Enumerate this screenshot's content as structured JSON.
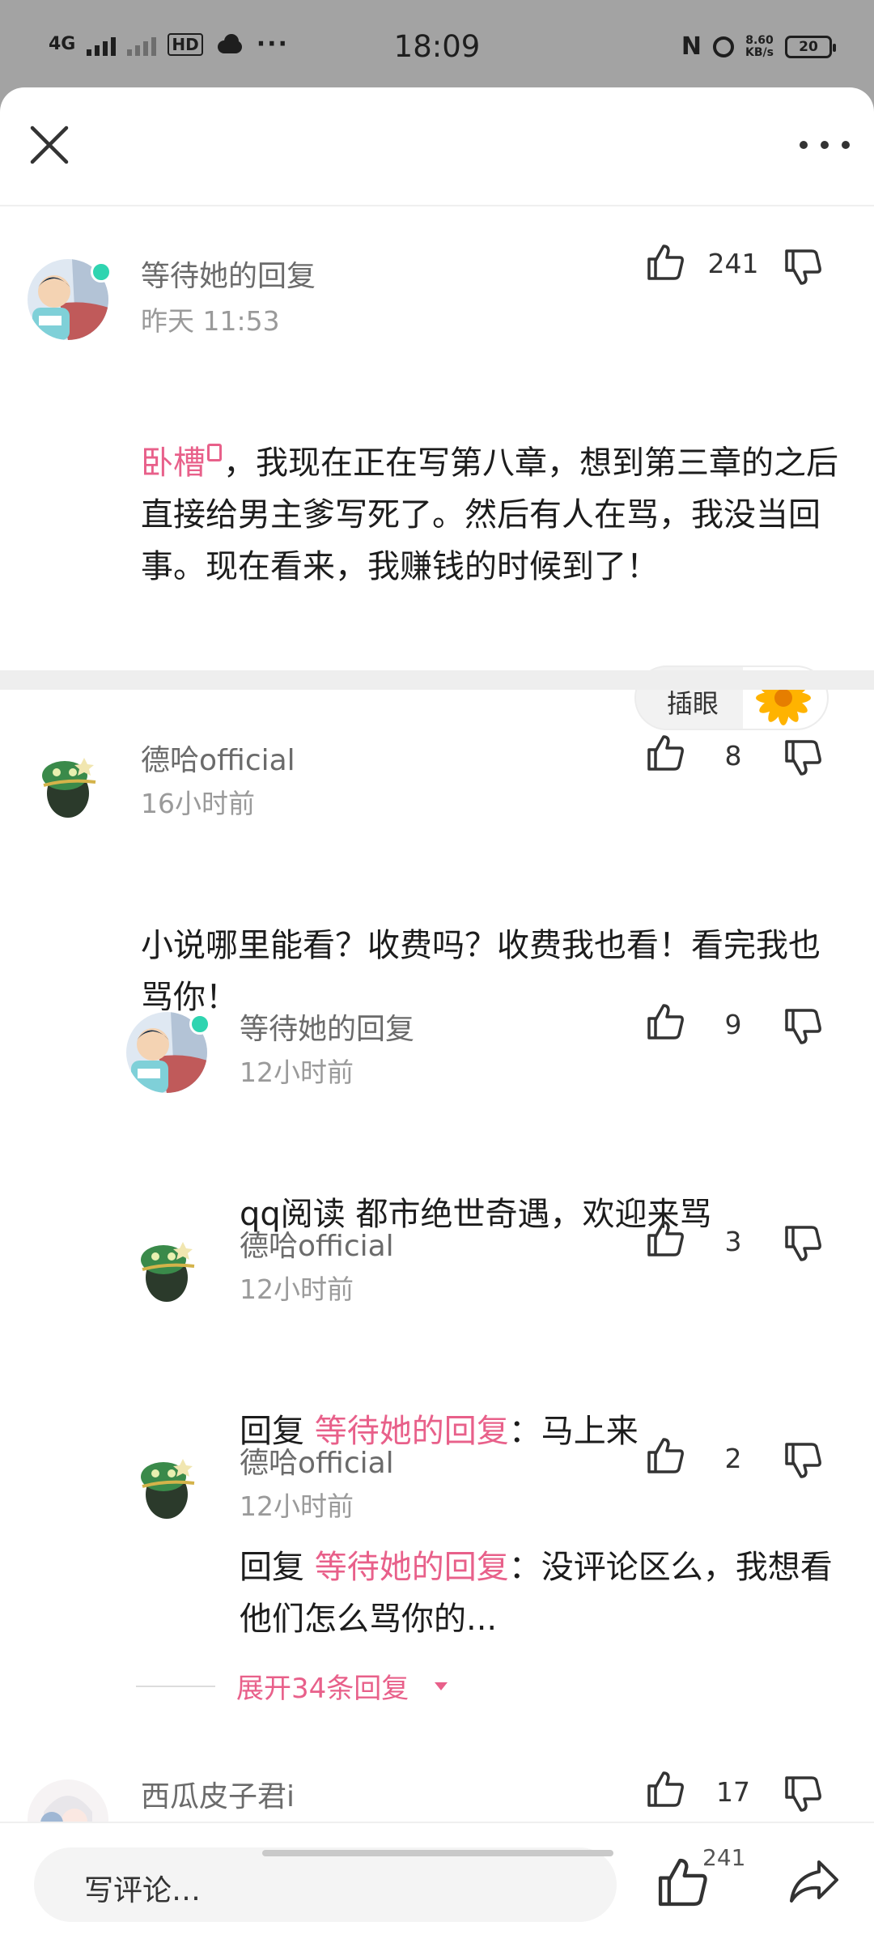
{
  "status_bar": {
    "network": "4G",
    "hd": "HD",
    "time": "18:09",
    "nfc": "N",
    "speed_value": "8.60",
    "speed_unit": "KB/s",
    "battery": "20"
  },
  "comments": [
    {
      "username": "等待她的回复",
      "time": "昨天 11:53",
      "likes": "241",
      "body_highlight": "卧槽",
      "body_rest": "，我现在正在写第八章，想到第三章的之后直接给男主爹写死了。然后有人在骂，我没当回事。现在看来，我赚钱的时候到了！",
      "chip_label": "插眼"
    },
    {
      "username": "德哈official",
      "time": "16小时前",
      "likes": "8",
      "body": "小说哪里能看？收费吗？收费我也看！看完我也骂你！"
    }
  ],
  "replies": [
    {
      "username": "等待她的回复",
      "time": "12小时前",
      "likes": "9",
      "body": "qq阅读 都市绝世奇遇，欢迎来骂"
    },
    {
      "username": "德哈official",
      "time": "12小时前",
      "likes": "3",
      "reply_prefix": "回复 ",
      "reply_target": "等待她的回复",
      "body": "：马上来"
    },
    {
      "username": "德哈official",
      "time": "12小时前",
      "likes": "2",
      "reply_prefix": "回复 ",
      "reply_target": "等待她的回复",
      "body": "：没评论区么，我想看他们怎么骂你的..."
    }
  ],
  "expand_replies": "展开34条回复",
  "next_comment": {
    "username": "西瓜皮子君i",
    "likes": "17"
  },
  "bottom_bar": {
    "input_placeholder": "写评论…",
    "like_count": "241"
  },
  "colors": {
    "accent_pink": "#e8608a",
    "online_dot": "#2fd4b0"
  }
}
